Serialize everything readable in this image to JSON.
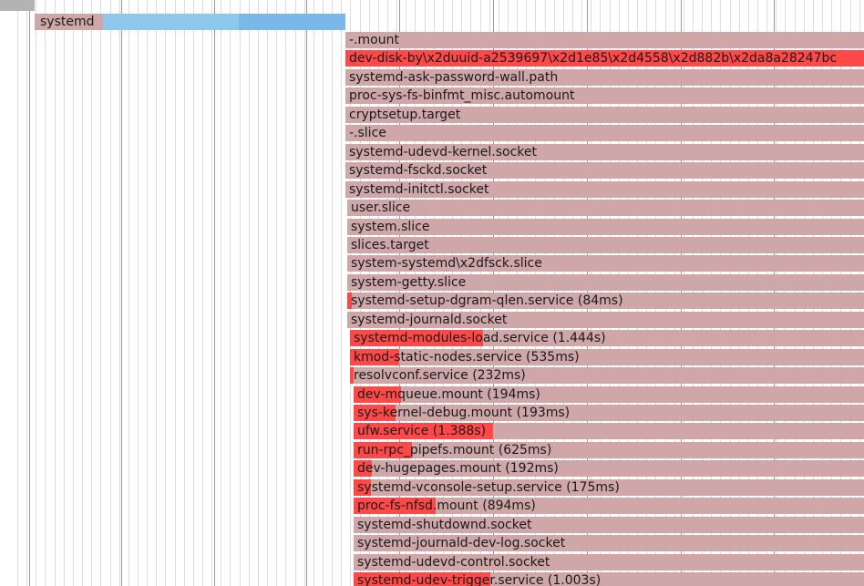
{
  "colors": {
    "background": "#ffffff",
    "grid_minor": "#dcdcdc",
    "grid_major": "#9a9a9a",
    "inactive": "#cfa7a8",
    "active": "#ff4848",
    "kernel_light": "#8ec8ec",
    "kernel_mid": "#7ab8ea",
    "text": "#1a1a1a"
  },
  "kernel": {
    "label": "systemd"
  },
  "units": [
    {
      "label": "-.mount"
    },
    {
      "label": "dev-disk-by\\x2duuid-a2539697\\x2d1e85\\x2d4558\\x2d882b\\x2da8a28247bc",
      "active": true
    },
    {
      "label": "systemd-ask-password-wall.path"
    },
    {
      "label": "proc-sys-fs-binfmt_misc.automount"
    },
    {
      "label": "cryptsetup.target"
    },
    {
      "label": "-.slice"
    },
    {
      "label": "systemd-udevd-kernel.socket"
    },
    {
      "label": "systemd-fsckd.socket"
    },
    {
      "label": "systemd-initctl.socket"
    },
    {
      "label": "user.slice"
    },
    {
      "label": "system.slice"
    },
    {
      "label": "slices.target"
    },
    {
      "label": "system-systemd\\x2dfsck.slice"
    },
    {
      "label": "system-getty.slice"
    },
    {
      "label": "systemd-setup-dgram-qlen.service (84ms)",
      "active": true
    },
    {
      "label": "systemd-journald.socket"
    },
    {
      "label": "systemd-modules-load.service (1.444s)",
      "active": true
    },
    {
      "label": "kmod-static-nodes.service (535ms)",
      "active": true
    },
    {
      "label": "resolvconf.service (232ms)",
      "active": true
    },
    {
      "label": "dev-mqueue.mount (194ms)",
      "active": true
    },
    {
      "label": "sys-kernel-debug.mount (193ms)",
      "active": true
    },
    {
      "label": "ufw.service (1.388s)",
      "active": true
    },
    {
      "label": "run-rpc_pipefs.mount (625ms)",
      "active": true
    },
    {
      "label": "dev-hugepages.mount (192ms)",
      "active": true
    },
    {
      "label": "systemd-vconsole-setup.service (175ms)",
      "active": true
    },
    {
      "label": "proc-fs-nfsd.mount (894ms)",
      "active": true
    },
    {
      "label": "systemd-shutdownd.socket"
    },
    {
      "label": "systemd-journald-dev-log.socket"
    },
    {
      "label": "systemd-udevd-control.socket"
    },
    {
      "label": "systemd-udev-trigger.service (1.003s)",
      "active": true
    }
  ]
}
